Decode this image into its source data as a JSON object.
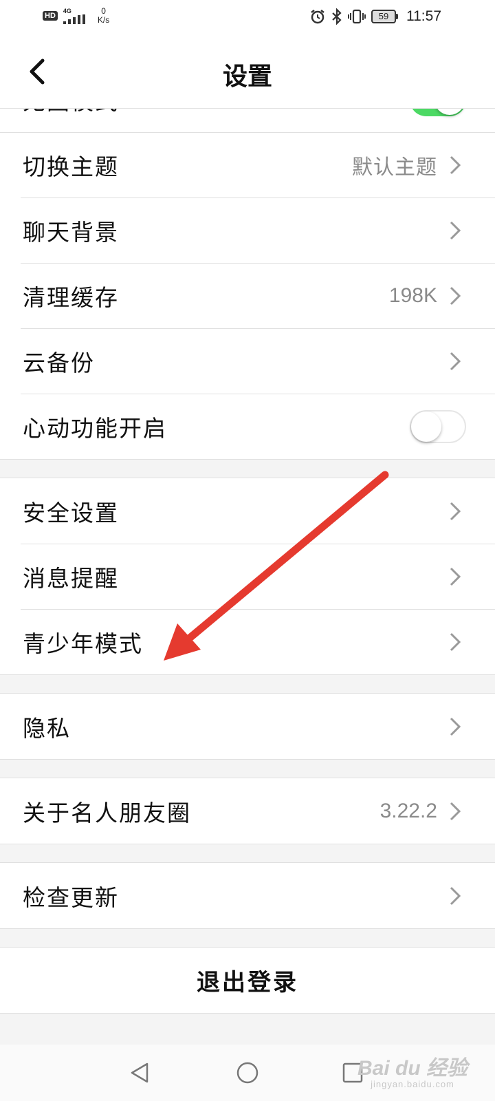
{
  "status_bar": {
    "hd": "HD",
    "network": "4G",
    "speed_value": "0",
    "speed_unit": "K/s",
    "battery": "59",
    "time": "11:57"
  },
  "header": {
    "title": "设置",
    "back_icon": "chevron-left-icon"
  },
  "settings": {
    "group1": {
      "partial_label": "无图模式",
      "partial_toggle_on": true,
      "items": [
        {
          "label": "切换主题",
          "value": "默认主题"
        },
        {
          "label": "聊天背景",
          "value": ""
        },
        {
          "label": "清理缓存",
          "value": "198K"
        },
        {
          "label": "云备份",
          "value": ""
        },
        {
          "label": "心动功能开启",
          "toggle_on": false
        }
      ]
    },
    "group2": {
      "items": [
        {
          "label": "安全设置"
        },
        {
          "label": "消息提醒"
        },
        {
          "label": "青少年模式"
        }
      ]
    },
    "group3": {
      "items": [
        {
          "label": "隐私"
        }
      ]
    },
    "group4": {
      "items": [
        {
          "label": "关于名人朋友圈",
          "value": "3.22.2"
        }
      ]
    },
    "group5": {
      "items": [
        {
          "label": "检查更新"
        }
      ]
    },
    "logout": "退出登录"
  },
  "nav": {
    "back": "triangle-back-icon",
    "home": "circle-home-icon",
    "recents": "square-recents-icon"
  },
  "watermark": {
    "main": "Bai du 经验",
    "sub": "jingyan.baidu.com"
  },
  "colors": {
    "toggle_on": "#4cd964",
    "annotation_arrow": "#e53a2f",
    "secondary_text": "#8a8a8a"
  }
}
